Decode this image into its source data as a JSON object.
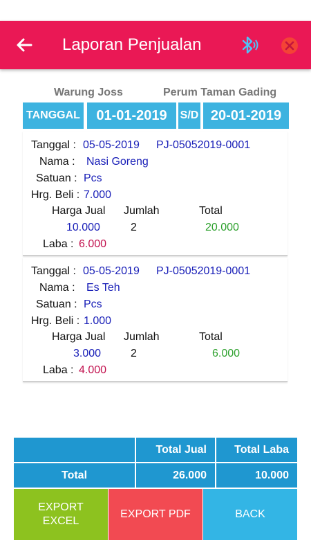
{
  "app_bar": {
    "title": "Laporan Penjualan",
    "back_icon": "arrow-left-icon",
    "bluetooth_icon": "bluetooth-icon",
    "close_icon": "close-circle-icon",
    "color": "#ea1855"
  },
  "store": {
    "name": "Warung Joss",
    "address": "Perum Taman Gading"
  },
  "period": {
    "label": "TANGGAL",
    "start": "01-01-2019",
    "separator": "S/D",
    "end": "20-01-2019"
  },
  "labels": {
    "tanggal": "Tanggal :",
    "nama": "Nama  :",
    "satuan": "Satuan :",
    "hrg_beli": "Hrg. Beli :",
    "harga_jual": "Harga Jual",
    "jumlah": "Jumlah",
    "total": "Total",
    "laba": "Laba :"
  },
  "items": [
    {
      "date": "05-05-2019",
      "code": "PJ-05052019-0001",
      "name": "Nasi Goreng",
      "unit": "Pcs",
      "buy_price": "7.000",
      "sell_price": "10.000",
      "qty": "2",
      "total": "20.000",
      "profit": "6.000"
    },
    {
      "date": "05-05-2019",
      "code": "PJ-05052019-0001",
      "name": "Es Teh",
      "unit": "Pcs",
      "buy_price": "1.000",
      "sell_price": "3.000",
      "qty": "2",
      "total": "6.000",
      "profit": "4.000"
    }
  ],
  "summary": {
    "header_total_jual": "Total Jual",
    "header_total_laba": "Total Laba",
    "row_label": "Total",
    "total_jual": "26.000",
    "total_laba": "10.000"
  },
  "buttons": {
    "export_excel": "EXPORT EXCEL",
    "export_pdf": "EXPORT PDF",
    "back": "BACK"
  },
  "colors": {
    "header_blue": "#3db3e0",
    "summary_blue": "#1f97d0",
    "excel_green": "#8dc21f",
    "pdf_red": "#f24a52",
    "back_blue": "#33b5e5"
  }
}
